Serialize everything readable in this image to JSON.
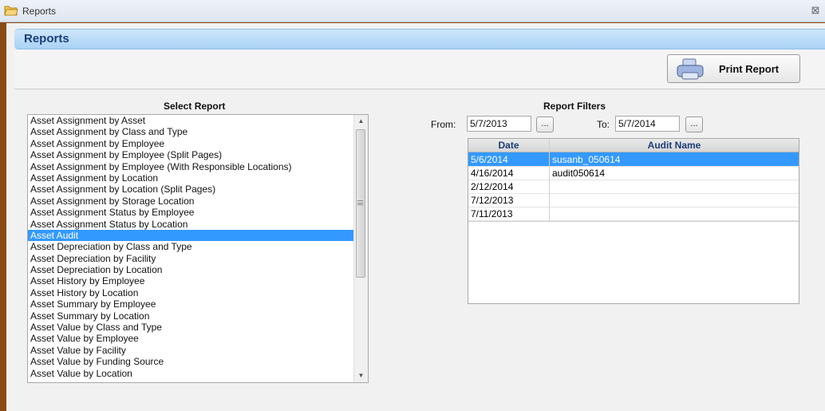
{
  "window": {
    "title": "Reports",
    "close_glyph": "⊠"
  },
  "header": {
    "title": "Reports"
  },
  "toolbar": {
    "print_label": "Print Report"
  },
  "select_report": {
    "heading": "Select Report",
    "items": [
      "Asset Assignment by Asset",
      "Asset Assignment by Class and Type",
      "Asset Assignment by Employee",
      "Asset Assignment by Employee (Split Pages)",
      "Asset Assignment by Employee (With Responsible Locations)",
      "Asset Assignment by Location",
      "Asset Assignment by Location (Split Pages)",
      "Asset Assignment by Storage Location",
      "Asset Assignment Status by Employee",
      "Asset Assignment Status by Location",
      "Asset Audit",
      "Asset Depreciation by Class and Type",
      "Asset Depreciation by Facility",
      "Asset Depreciation by Location",
      "Asset History by Employee",
      "Asset History by Location",
      "Asset Summary by Employee",
      "Asset Summary by Location",
      "Asset Value by Class and Type",
      "Asset Value by Employee",
      "Asset Value by Facility",
      "Asset Value by Funding Source",
      "Asset Value by Location"
    ],
    "selected_index": 10,
    "scroll_up_glyph": "▲",
    "scroll_down_glyph": "▼"
  },
  "filters": {
    "heading": "Report Filters",
    "from_label": "From:",
    "from_value": "5/7/2013",
    "to_label": "To:",
    "to_value": "5/7/2014",
    "picker_label": "..."
  },
  "audit_grid": {
    "columns": [
      "Date",
      "Audit Name"
    ],
    "rows": [
      {
        "date": "5/6/2014",
        "name": "susanb_050614"
      },
      {
        "date": "4/16/2014",
        "name": "audit050614"
      },
      {
        "date": "2/12/2014",
        "name": ""
      },
      {
        "date": "7/12/2013",
        "name": ""
      },
      {
        "date": "7/11/2013",
        "name": ""
      }
    ],
    "selected_index": 0
  },
  "colors": {
    "selection": "#3399ff",
    "header_blue": "#a9d2f5",
    "frame_brown": "#8a4a14"
  },
  "icons": {
    "app": "folder-icon",
    "print": "printer-icon",
    "close": "close-icon"
  }
}
